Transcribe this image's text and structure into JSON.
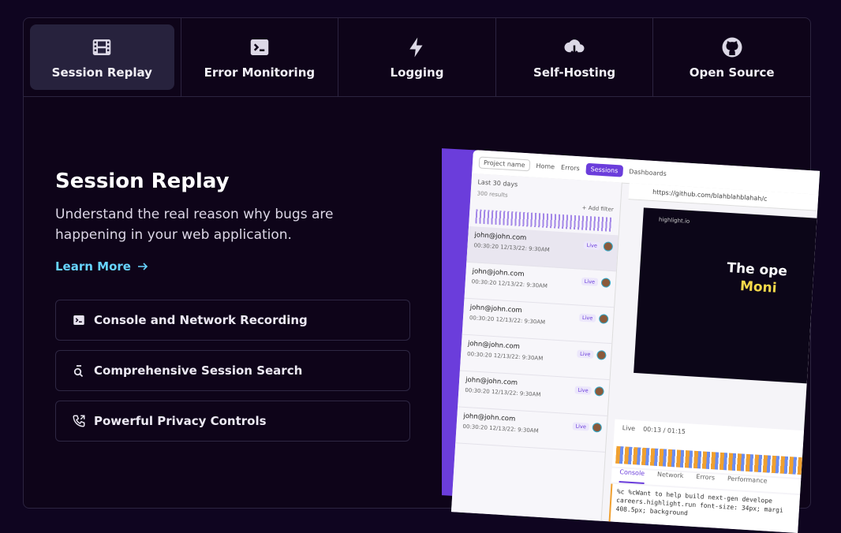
{
  "tabs": [
    {
      "label": "Session Replay",
      "icon": "film-icon",
      "active": true
    },
    {
      "label": "Error Monitoring",
      "icon": "terminal-icon",
      "active": false
    },
    {
      "label": "Logging",
      "icon": "lightning-icon",
      "active": false
    },
    {
      "label": "Self-Hosting",
      "icon": "cloud-download-icon",
      "active": false
    },
    {
      "label": "Open Source",
      "icon": "github-icon",
      "active": false
    }
  ],
  "content": {
    "title": "Session Replay",
    "description": "Understand the real reason why bugs are happening in your web application.",
    "learn_more": "Learn More",
    "features": [
      {
        "label": "Console and Network Recording",
        "icon": "terminal-icon"
      },
      {
        "label": "Comprehensive Session Search",
        "icon": "search-icon"
      },
      {
        "label": "Powerful Privacy Controls",
        "icon": "phone-icon"
      }
    ]
  },
  "preview": {
    "nav": [
      "Project name",
      "Home",
      "Errors",
      "Sessions",
      "Dashboards"
    ],
    "filter": "Last 30 days",
    "results": "300 results",
    "add_filter": "+ Add filter",
    "url": "https://github.com/blahblahblahah/c",
    "sessions": [
      {
        "email": "john@john.com",
        "meta": "00:30:20  12/13/22: 9:30AM",
        "live": "Live"
      },
      {
        "email": "john@john.com",
        "meta": "00:30:20  12/13/22: 9:30AM",
        "live": "Live"
      },
      {
        "email": "john@john.com",
        "meta": "00:30:20  12/13/22: 9:30AM",
        "live": "Live"
      },
      {
        "email": "john@john.com",
        "meta": "00:30:20  12/13/22: 9:30AM",
        "live": "Live"
      },
      {
        "email": "john@john.com",
        "meta": "00:30:20  12/13/22: 9:30AM",
        "live": "Live"
      },
      {
        "email": "john@john.com",
        "meta": "00:30:20  12/13/22: 9:30AM",
        "live": "Live"
      }
    ],
    "site_brand": "highlight.io",
    "site_heading_1": "The ope",
    "site_heading_2": "Moni",
    "time": "00:13 / 01:15",
    "live": "Live",
    "devtools": [
      "Console",
      "Network",
      "Errors",
      "Performance"
    ],
    "console_text": "%c %cWant to help build next-gen develope careers.highlight.run font-size: 34px; margi 408.5px; background"
  },
  "colors": {
    "bg": "#0f0520",
    "active_tab": "#27223d",
    "link": "#67d4ff",
    "accent": "#6b3ddb"
  }
}
